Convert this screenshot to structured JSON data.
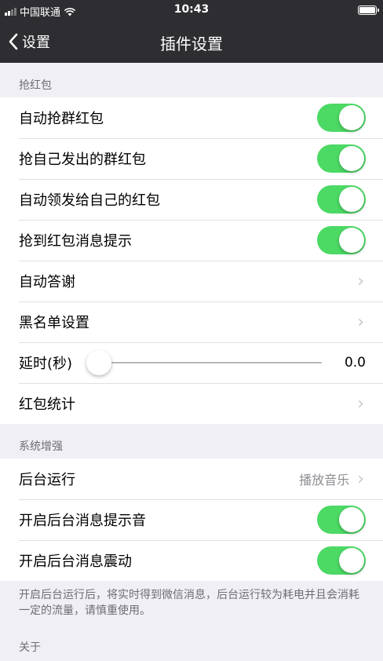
{
  "status_bar": {
    "carrier": "中国联通",
    "time": "10:43",
    "signal_bars": 2,
    "signal_total": 4,
    "battery_level": 1.0,
    "icons": [
      "signal-icon",
      "wifi-icon",
      "battery-icon"
    ]
  },
  "nav": {
    "back_label": "设置",
    "title": "插件设置"
  },
  "sections": {
    "red_packet": {
      "header": "抢红包",
      "rows": [
        {
          "label": "自动抢群红包",
          "control": "toggle",
          "on": true
        },
        {
          "label": "抢自己发出的群红包",
          "control": "toggle",
          "on": true
        },
        {
          "label": "自动领发给自己的红包",
          "control": "toggle",
          "on": true
        },
        {
          "label": "抢到红包消息提示",
          "control": "toggle",
          "on": true
        },
        {
          "label": "自动答谢",
          "control": "disclosure"
        },
        {
          "label": "黑名单设置",
          "control": "disclosure"
        },
        {
          "label": "延时(秒)",
          "control": "slider",
          "value": "0.0",
          "fraction": 0.0
        },
        {
          "label": "红包统计",
          "control": "disclosure"
        }
      ]
    },
    "system": {
      "header": "系统增强",
      "rows": [
        {
          "label": "后台运行",
          "control": "disclosure",
          "value": "播放音乐"
        },
        {
          "label": "开启后台消息提示音",
          "control": "toggle",
          "on": true
        },
        {
          "label": "开启后台消息震动",
          "control": "toggle",
          "on": true
        }
      ],
      "footer": "开启后台运行后，将实时得到微信消息，后台运行较为耗电并且会消耗一定的流量，请慎重使用。"
    },
    "about": {
      "header": "关于"
    }
  },
  "colors": {
    "nav_bg": "#2e2d31",
    "toggle_on": "#4cd964",
    "page_bg": "#efeff4",
    "section_text": "#6d6d72",
    "slider_fill": "#007aff"
  }
}
